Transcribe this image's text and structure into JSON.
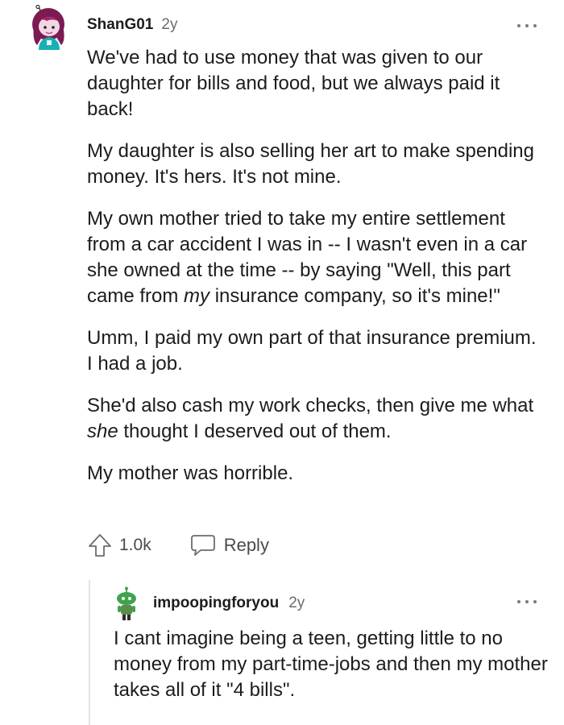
{
  "comment": {
    "author": "ShanG01",
    "age": "2y",
    "paragraphs": [
      {
        "runs": [
          {
            "text": "We've had to use money that was given to our daughter for bills and food, but we always paid it back!",
            "italic": false
          }
        ]
      },
      {
        "runs": [
          {
            "text": "My daughter is also selling her art to make spending money. It's hers. It's not mine.",
            "italic": false
          }
        ]
      },
      {
        "runs": [
          {
            "text": "My own mother tried to take my entire settlement from a car accident I was in -- I wasn't even in a car she owned at the time -- by saying \"Well, this part came from ",
            "italic": false
          },
          {
            "text": "my",
            "italic": true
          },
          {
            "text": " insurance company, so it's mine!\"",
            "italic": false
          }
        ]
      },
      {
        "runs": [
          {
            "text": "Umm, I paid my own part of that insurance premium. I had a job.",
            "italic": false
          }
        ]
      },
      {
        "runs": [
          {
            "text": "She'd also cash my work checks, then give me what ",
            "italic": false
          },
          {
            "text": "she",
            "italic": true
          },
          {
            "text": " thought I deserved out of them.",
            "italic": false
          }
        ]
      },
      {
        "runs": [
          {
            "text": "My mother was horrible.",
            "italic": false
          }
        ]
      }
    ],
    "upvotes": "1.0k",
    "reply_label": "Reply",
    "icons": {
      "upvote": "upvote-arrow-icon",
      "reply": "speech-bubble-icon",
      "more": "more-options-icon"
    }
  },
  "reply": {
    "author": "impoopingforyou",
    "age": "2y",
    "text": "I cant imagine being a teen, getting little to no money from my part-time-jobs and then my mother takes all of it \"4 bills\"."
  },
  "colors": {
    "text": "#1c1c1c",
    "meta": "#6b6b6b",
    "action": "#4a4a4a",
    "avatar_hair": "#7b1b52",
    "avatar_shirt": "#19b0b4",
    "reply_avatar_green": "#3fa34d"
  }
}
